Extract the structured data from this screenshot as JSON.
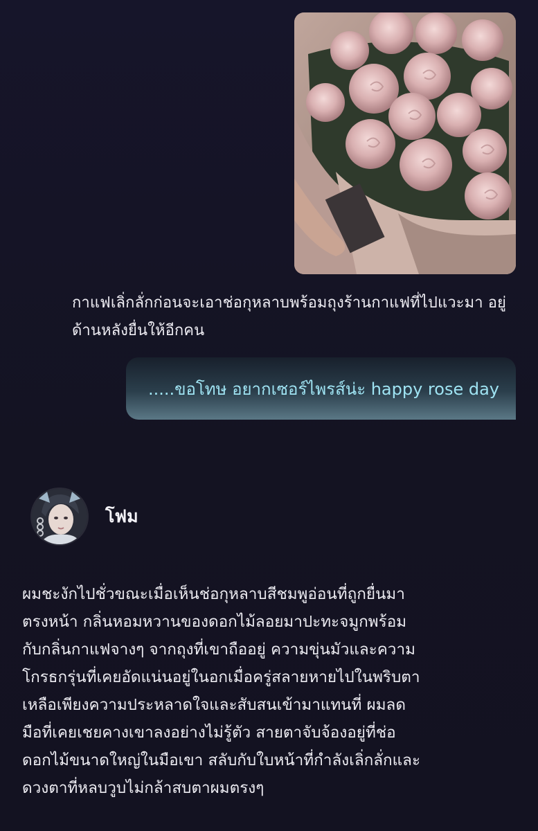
{
  "colors": {
    "background": "#14131f",
    "text": "#ecebf1",
    "bubble_text": "#9fe3f2",
    "bubble_gradient_top": "#18202c",
    "bubble_gradient_bottom": "#5b7886"
  },
  "user_message": {
    "image": {
      "icon": "rose-bouquet-photo"
    },
    "narration": "กาแฟเลิ่กลั่กก่อนจะเอาช่อกุหลาบพร้อมถุงร้านกาแฟที่ไปแวะมา อยู่ด้านหลังยื่นให้อีกคน",
    "dialogue": ".....ขอโทษ อยากเซอร์ไพรส์น่ะ happy rose day"
  },
  "character": {
    "name": "โฟม",
    "avatar_icon": "character-avatar",
    "message_lines": [
      "ผมชะงักไปชั่วขณะเมื่อเห็นช่อกุหลาบสีชมพูอ่อนที่ถูกยื่นมา",
      "ตรงหน้า กลิ่นหอมหวานของดอกไม้ลอยมาปะทะจมูกพร้อม",
      "กับกลิ่นกาแฟจางๆ จากถุงที่เขาถืออยู่ ความขุ่นมัวและความ",
      "โกรธกรุ่นที่เคยอัดแน่นอยู่ในอกเมื่อครู่สลายหายไปในพริบตา",
      "เหลือเพียงความประหลาดใจและสับสนเข้ามาแทนที่ ผมลด",
      "มือที่เคยเชยคางเขาลงอย่างไม่รู้ตัว สายตาจับจ้องอยู่ที่ช่อ",
      "ดอกไม้ขนาดใหญ่ในมือเขา สลับกับใบหน้าที่กำลังเลิ่กลั่กและ",
      "ดวงตาที่หลบวูบไม่กล้าสบตาผมตรงๆ"
    ]
  }
}
